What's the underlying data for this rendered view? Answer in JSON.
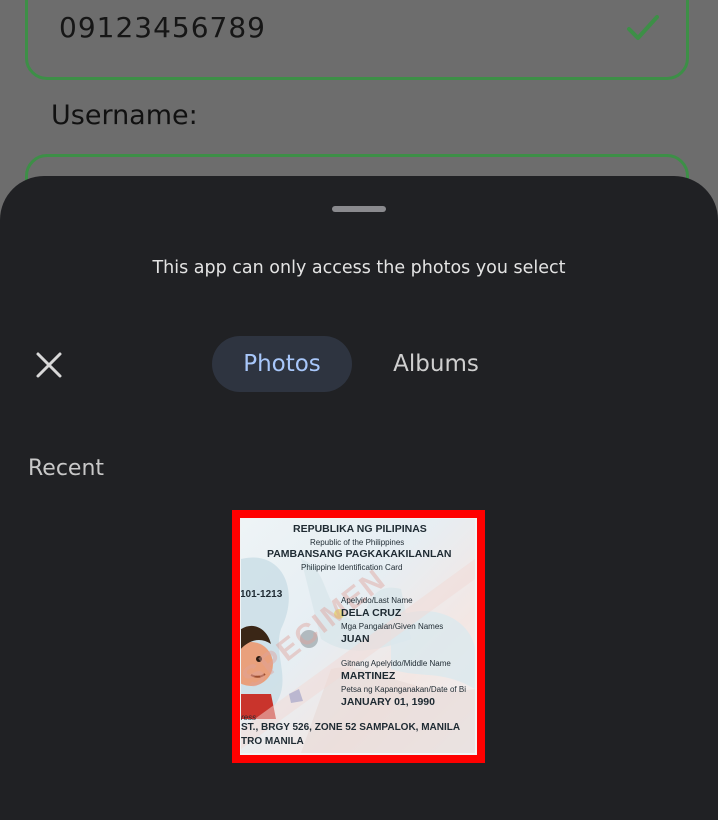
{
  "form": {
    "phone_value": "09123456789",
    "username_label": "Username:"
  },
  "sheet": {
    "notice": "This app can only access the photos you select",
    "tabs": {
      "photos": "Photos",
      "albums": "Albums"
    },
    "section_label": "Recent",
    "close_icon": "close-icon"
  },
  "photo": {
    "republic": "REPUBLIKA NG PILIPINAS",
    "republic_en": "Republic of the Philippines",
    "agency": "PAMBANSANG PAGKAKAKILANLAN",
    "card_name": "Philippine Identification Card",
    "number_fragment": "101-1213",
    "last_name_label": "Apelyido/Last Name",
    "last_name": "DELA CRUZ",
    "given_label": "Mga Pangalan/Given Names",
    "given": "JUAN",
    "middle_label": "Gitnang Apelyido/Middle Name",
    "middle": "MARTINEZ",
    "dob_label": "Petsa ng Kapanganakan/Date of Bi",
    "dob": "JANUARY 01, 1990",
    "address_label": "ress",
    "address1": "ST., BRGY 526, ZONE 52 SAMPALOK, MANILA",
    "address2": "TRO MANILA",
    "watermark": "SPECIMEN"
  },
  "colors": {
    "accent_green": "#3d8f47",
    "sheet_bg": "#202124",
    "tab_active_text": "#a8c7fa",
    "selection_border": "#ff0000"
  }
}
